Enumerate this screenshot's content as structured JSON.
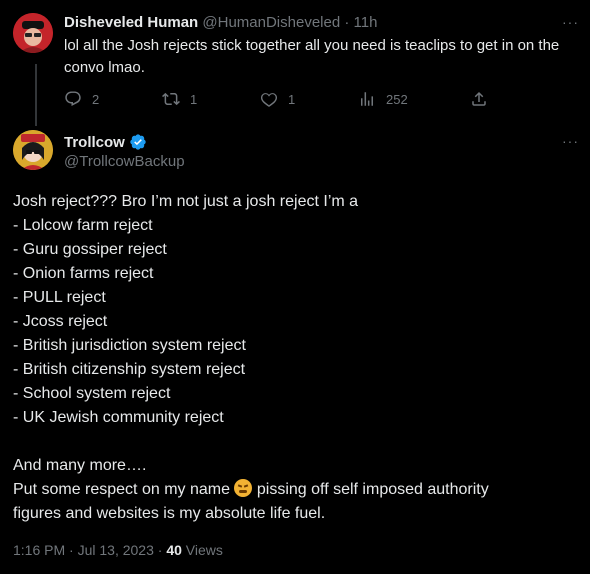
{
  "reply": {
    "name": "Disheveled Human",
    "handle": "@HumanDisheveled",
    "sep": "·",
    "time": "11h",
    "more": "···",
    "text_line1": "lol all the Josh rejects stick together all you need is teaclips to get in on the",
    "text_line2": "convo lmao.",
    "actions": {
      "replies": "2",
      "reposts": "1",
      "likes": "1",
      "views": "252"
    }
  },
  "main": {
    "name": "Trollcow",
    "handle": "@TrollcowBackup",
    "more": "···",
    "lines": [
      "Josh reject??? Bro I’m not just a josh reject I’m a",
      "- Lolcow farm reject",
      "- Guru gossiper reject",
      "- Onion farms reject",
      "- PULL reject",
      "- Jcoss reject",
      "- British jurisdiction system reject",
      "- British citizenship system reject",
      "- School system reject",
      "- UK Jewish community reject",
      "",
      "And many more….",
      "Put some respect on my name",
      "pissing off self imposed authority",
      "figures  and websites is my absolute life fuel."
    ],
    "meta": {
      "timestamp": "1:16 PM · Jul 13, 2023 ·",
      "views_count": "40",
      "views_label": "Views"
    }
  },
  "colors": {
    "background": "#000000",
    "text": "#e7e9ea",
    "muted": "#71767b",
    "verified": "#1d9bf0"
  }
}
